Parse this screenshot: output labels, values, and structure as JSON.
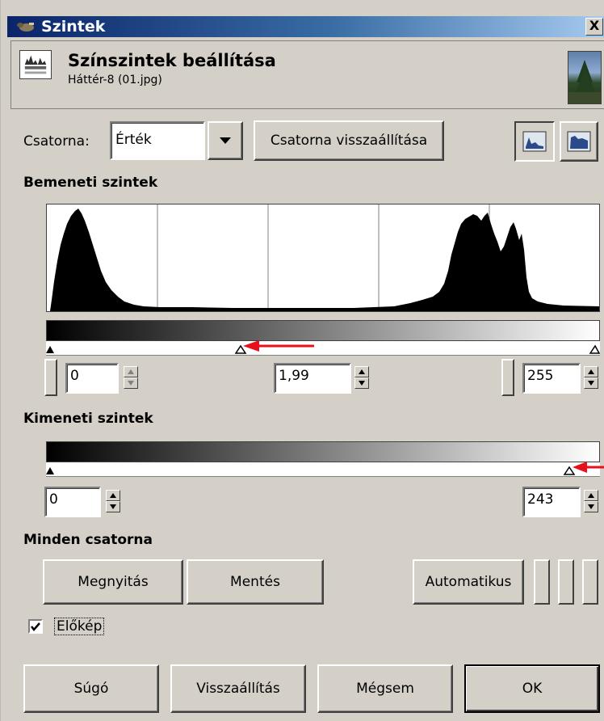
{
  "window": {
    "title": "Szintek",
    "close_glyph": "X",
    "title_icon": "gimp-icon"
  },
  "header": {
    "title": "Színszintek beállítása",
    "subtitle": "Háttér-8 (01.jpg)",
    "icon": "levels-icon",
    "thumbnail": "image-thumbnail"
  },
  "channel": {
    "label": "Csatorna:",
    "value": "Érték",
    "reset_label": "Csatorna visszaállítása",
    "linear_histogram_icon": "linear-histogram-icon",
    "log_histogram_icon": "logarithmic-histogram-icon"
  },
  "input_levels": {
    "heading": "Bemeneti szintek",
    "low": "0",
    "gamma": "1,99",
    "high": "255"
  },
  "output_levels": {
    "heading": "Kimeneti szintek",
    "low": "0",
    "high": "243"
  },
  "all_channels": {
    "heading": "Minden csatorna",
    "open_label": "Megnyitás",
    "save_label": "Mentés",
    "auto_label": "Automatikus"
  },
  "preview": {
    "label": "Előkép",
    "checked": true
  },
  "buttons": {
    "help": "Súgó",
    "reset": "Visszaállítás",
    "cancel": "Mégsem",
    "ok": "OK"
  },
  "colors": {
    "dialog_bg": "#d4d0c8",
    "titlebar_start": "#0a246a",
    "titlebar_end": "#a6caf0",
    "annotation_arrow": "#e8101a"
  }
}
